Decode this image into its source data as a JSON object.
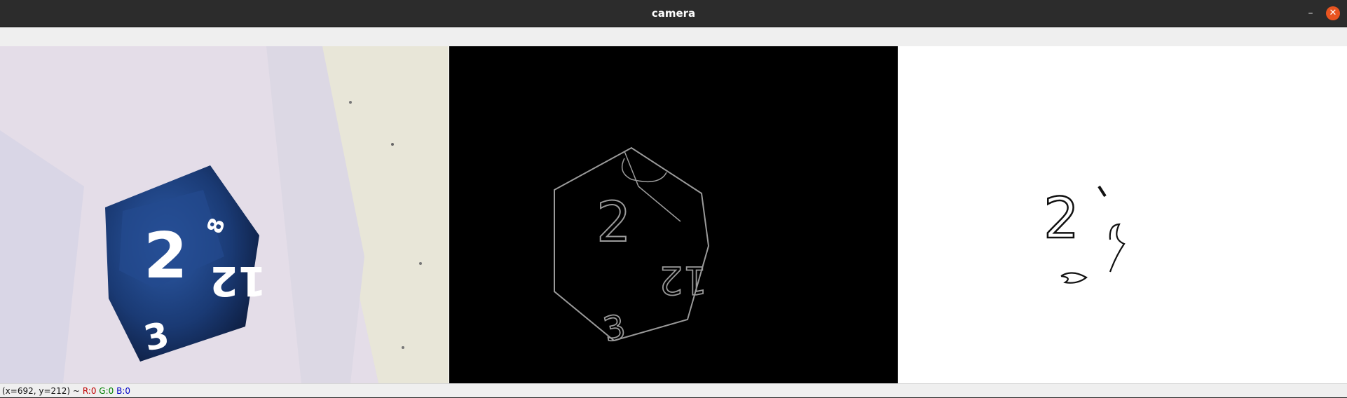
{
  "window": {
    "title": "camera"
  },
  "controls": {
    "minimize_glyph": "–",
    "close_glyph": "✕"
  },
  "status": {
    "coords": "(x=692, y=212) ~",
    "r": "R:0",
    "g": "G:0",
    "b": "B:0"
  },
  "panels": {
    "original": {
      "face_2": "2",
      "face_12": "12",
      "face_3": "3",
      "face_8": "8"
    },
    "edges": {
      "face_2": "2",
      "face_12": "12",
      "face_3": "3"
    },
    "threshold": {
      "face_2": "2"
    }
  },
  "colors": {
    "titlebar": "#2c2c2c",
    "close": "#e95420",
    "die": "#1c3f7a"
  }
}
